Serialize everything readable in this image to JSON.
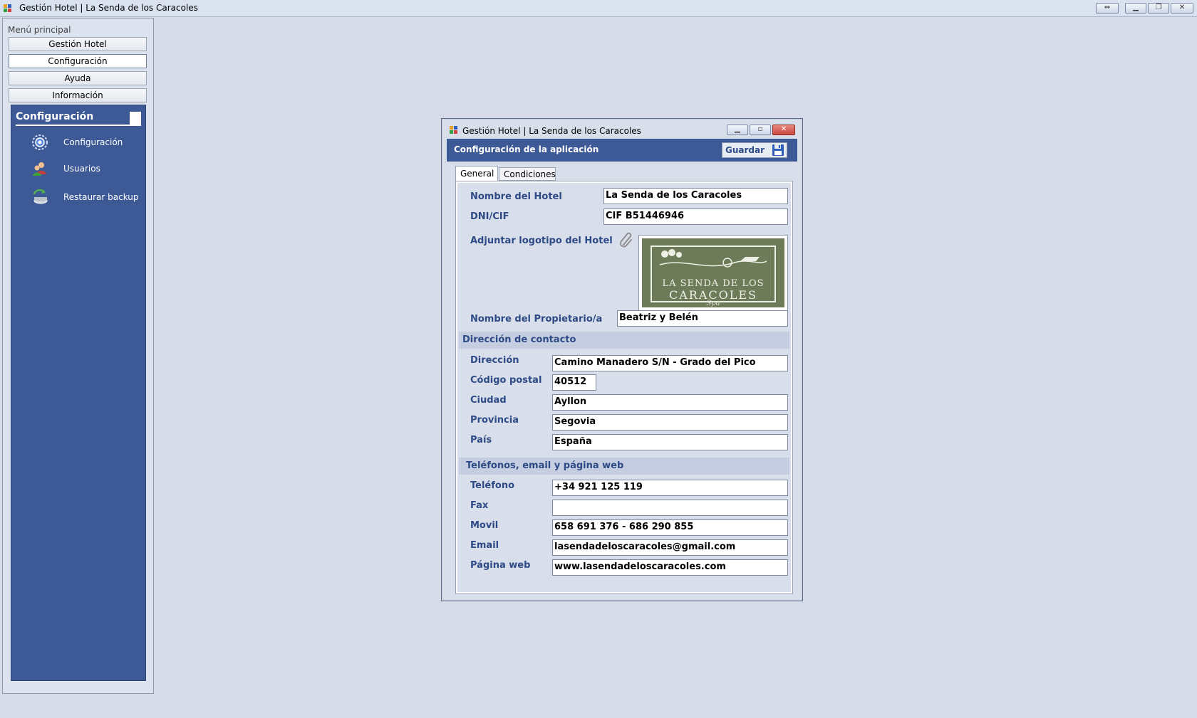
{
  "window": {
    "title": "Gestión Hotel | La Senda de los Caracoles"
  },
  "sidebar": {
    "caption": "Menú principal",
    "menu": [
      {
        "label": "Gestión Hotel"
      },
      {
        "label": "Configuración"
      },
      {
        "label": "Ayuda"
      },
      {
        "label": "Información"
      }
    ],
    "section_title": "Configuración",
    "items": [
      {
        "label": "Configuración",
        "icon": "settings-gear-icon"
      },
      {
        "label": "Usuarios",
        "icon": "users-icon"
      },
      {
        "label": "Restaurar backup",
        "icon": "restore-backup-icon"
      }
    ]
  },
  "dialog": {
    "title": "Gestión Hotel | La Senda de los Caracoles",
    "heading": "Configuración de la aplicación",
    "save_label": "Guardar",
    "tabs": [
      {
        "label": "General"
      },
      {
        "label": "Condiciones"
      }
    ],
    "general": {
      "hotel_name_label": "Nombre del Hotel",
      "hotel_name": "La Senda de los Caracoles",
      "dni_label": "DNI/CIF",
      "dni": "CIF B51446946",
      "logo_label": "Adjuntar logotipo del Hotel",
      "logo_text": {
        "line1": "LA SENDA DE LOS",
        "line2": "CARACOLES",
        "line3": "Spa"
      },
      "owner_label": "Nombre del Propietario/a",
      "owner": "Beatriz y Belén"
    },
    "address_section": "Dirección de contacto",
    "address": {
      "direccion_label": "Dirección",
      "direccion": "Camino Manadero S/N - Grado del Pico",
      "cp_label": "Código postal",
      "cp": "40512",
      "ciudad_label": "Ciudad",
      "ciudad": "Ayllon",
      "provincia_label": "Provincia",
      "provincia": "Segovia",
      "pais_label": "País",
      "pais": "España"
    },
    "contact_section": "Teléfonos, email y página web",
    "contact": {
      "telefono_label": "Teléfono",
      "telefono": "+34 921 125 119",
      "fax_label": "Fax",
      "fax": "",
      "movil_label": "Movil",
      "movil": "658 691 376 - 686 290 855",
      "email_label": "Email",
      "email": "lasendadeloscaracoles@gmail.com",
      "web_label": "Página web",
      "web": "www.lasendadeloscaracoles.com"
    }
  },
  "colors": {
    "accent_blue": "#3d5a96",
    "label_blue": "#2d4a86",
    "background": "#d6dbe9",
    "close_red": "#c9463d"
  }
}
